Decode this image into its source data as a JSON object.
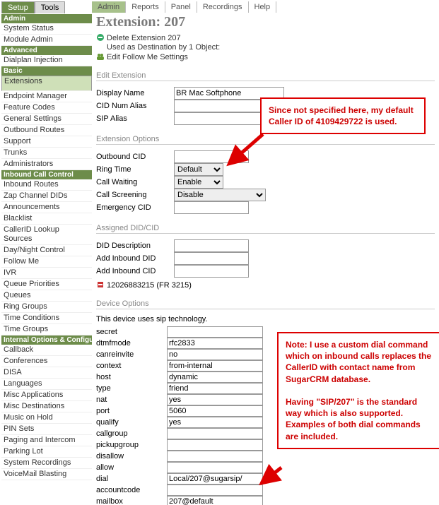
{
  "topmenu": [
    "Admin",
    "Reports",
    "Panel",
    "Recordings",
    "Help"
  ],
  "lefttabs": [
    "Setup",
    "Tools"
  ],
  "sidebar": [
    {
      "hdr": "Admin"
    },
    {
      "item": "System Status"
    },
    {
      "item": "Module Admin"
    },
    {
      "hdr": "Advanced"
    },
    {
      "item": "Dialplan Injection"
    },
    {
      "hdr": "Basic"
    },
    {
      "item": "Extensions",
      "sel": true
    },
    {
      "item": "Endpoint Manager"
    },
    {
      "item": "Feature Codes"
    },
    {
      "item": "General Settings"
    },
    {
      "item": "Outbound Routes"
    },
    {
      "item": "Support"
    },
    {
      "item": "Trunks"
    },
    {
      "item": "Administrators"
    },
    {
      "hdr": "Inbound Call Control"
    },
    {
      "item": "Inbound Routes"
    },
    {
      "item": "Zap Channel DIDs"
    },
    {
      "item": "Announcements"
    },
    {
      "item": "Blacklist"
    },
    {
      "item": "CallerID Lookup Sources"
    },
    {
      "item": "Day/Night Control"
    },
    {
      "item": "Follow Me"
    },
    {
      "item": "IVR"
    },
    {
      "item": "Queue Priorities"
    },
    {
      "item": "Queues"
    },
    {
      "item": "Ring Groups"
    },
    {
      "item": "Time Conditions"
    },
    {
      "item": "Time Groups"
    },
    {
      "hdr": "Internal Options & Configurati"
    },
    {
      "item": "Callback"
    },
    {
      "item": "Conferences"
    },
    {
      "item": "DISA"
    },
    {
      "item": "Languages"
    },
    {
      "item": "Misc Applications"
    },
    {
      "item": "Misc Destinations"
    },
    {
      "item": "Music on Hold"
    },
    {
      "item": "PIN Sets"
    },
    {
      "item": "Paging and Intercom"
    },
    {
      "item": "Parking Lot"
    },
    {
      "item": "System Recordings"
    },
    {
      "item": "VoiceMail Blasting"
    }
  ],
  "page": {
    "title": "Extension: 207",
    "delete": "Delete Extension 207",
    "usage": "Used as Destination by 1 Object:",
    "followme": "Edit Follow Me Settings"
  },
  "sec": {
    "edit": "Edit Extension",
    "extopts": "Extension Options",
    "assigned": "Assigned DID/CID",
    "device": "Device Options"
  },
  "edit": {
    "display_lbl": "Display Name",
    "display_val": "BR Mac Softphone",
    "cidnum_lbl": "CID Num Alias",
    "cidnum_val": "",
    "sipalias_lbl": "SIP Alias",
    "sipalias_val": ""
  },
  "extopts": {
    "obcid_lbl": "Outbound CID",
    "obcid_val": "",
    "ring_lbl": "Ring Time",
    "ring_val": "Default",
    "cw_lbl": "Call Waiting",
    "cw_val": "Enable",
    "cs_lbl": "Call Screening",
    "cs_val": "Disable",
    "ecid_lbl": "Emergency CID",
    "ecid_val": ""
  },
  "assigned": {
    "desc_lbl": "DID Description",
    "desc_val": "",
    "did_lbl": "Add Inbound DID",
    "did_val": "",
    "cid_lbl": "Add Inbound CID",
    "cid_val": "",
    "existing": "12026883215 (FR 3215)"
  },
  "device": {
    "intro": "This device uses sip technology.",
    "rows": [
      {
        "k": "secret",
        "v": ""
      },
      {
        "k": "dtmfmode",
        "v": "rfc2833"
      },
      {
        "k": "canreinvite",
        "v": "no"
      },
      {
        "k": "context",
        "v": "from-internal"
      },
      {
        "k": "host",
        "v": "dynamic"
      },
      {
        "k": "type",
        "v": "friend"
      },
      {
        "k": "nat",
        "v": "yes"
      },
      {
        "k": "port",
        "v": "5060"
      },
      {
        "k": "qualify",
        "v": "yes"
      },
      {
        "k": "callgroup",
        "v": ""
      },
      {
        "k": "pickupgroup",
        "v": ""
      },
      {
        "k": "disallow",
        "v": ""
      },
      {
        "k": "allow",
        "v": ""
      },
      {
        "k": "dial",
        "v": "Local/207@sugarsip/"
      },
      {
        "k": "accountcode",
        "v": ""
      },
      {
        "k": "mailbox",
        "v": "207@default"
      }
    ]
  },
  "callout1": "Since not specified here, my default Caller ID of 4109429722 is used.",
  "callout2": "Note: I use a custom dial command which on inbound calls replaces the CallerID with contact name from SugarCRM database.\n\nHaving \"SIP/207\" is the standard way which is also supported. Examples of both dial commands are included."
}
